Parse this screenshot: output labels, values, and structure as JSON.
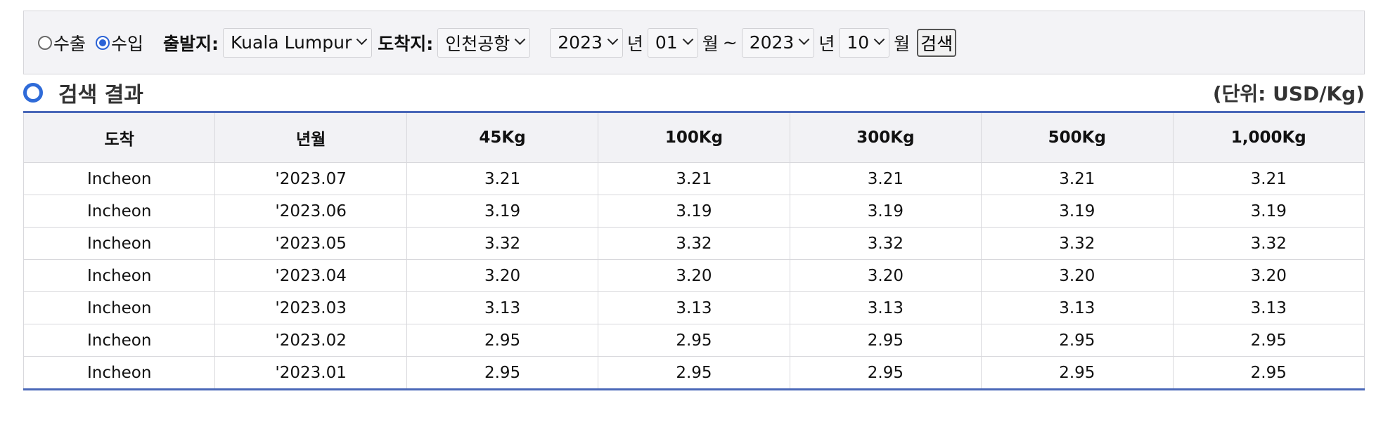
{
  "search": {
    "radio_export": "수출",
    "radio_import": "수입",
    "selected_mode": "import",
    "origin_label": "출발지:",
    "origin_value": "Kuala Lumpur",
    "destination_label": "도착지:",
    "destination_value": "인천공항",
    "start_year": "2023",
    "year_unit": "년",
    "start_month": "01",
    "month_unit": "월",
    "range_sep": "~",
    "end_year": "2023",
    "end_month": "10",
    "search_button": "검색"
  },
  "results": {
    "title": "검색 결과",
    "unit": "(단위: USD/Kg)",
    "columns": [
      "도착",
      "년월",
      "45Kg",
      "100Kg",
      "300Kg",
      "500Kg",
      "1,000Kg"
    ],
    "rows": [
      [
        "Incheon",
        "'2023.07",
        "3.21",
        "3.21",
        "3.21",
        "3.21",
        "3.21"
      ],
      [
        "Incheon",
        "'2023.06",
        "3.19",
        "3.19",
        "3.19",
        "3.19",
        "3.19"
      ],
      [
        "Incheon",
        "'2023.05",
        "3.32",
        "3.32",
        "3.32",
        "3.32",
        "3.32"
      ],
      [
        "Incheon",
        "'2023.04",
        "3.20",
        "3.20",
        "3.20",
        "3.20",
        "3.20"
      ],
      [
        "Incheon",
        "'2023.03",
        "3.13",
        "3.13",
        "3.13",
        "3.13",
        "3.13"
      ],
      [
        "Incheon",
        "'2023.02",
        "2.95",
        "2.95",
        "2.95",
        "2.95",
        "2.95"
      ],
      [
        "Incheon",
        "'2023.01",
        "2.95",
        "2.95",
        "2.95",
        "2.95",
        "2.95"
      ]
    ]
  },
  "colors": {
    "accent": "#2f6bd8",
    "table_border": "#4a68b8",
    "search_bg": "#f3f3f6"
  }
}
